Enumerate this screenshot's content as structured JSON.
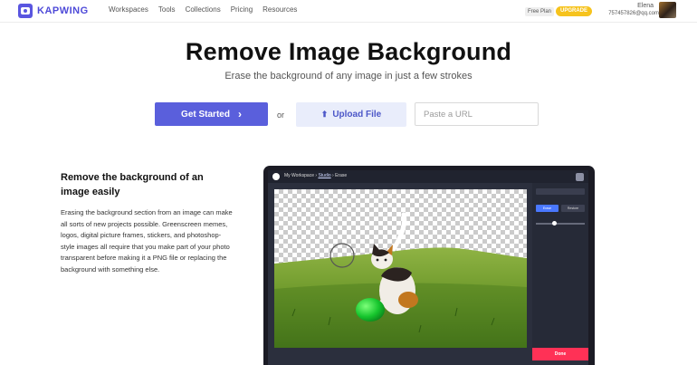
{
  "brand": {
    "name": "KAPWING"
  },
  "nav": {
    "items": [
      "Workspaces",
      "Tools",
      "Collections",
      "Pricing",
      "Resources"
    ]
  },
  "account": {
    "plan": "Free Plan",
    "upgrade": "UPGRADE",
    "name": "Elena",
    "email": "757457826@qq.com"
  },
  "hero": {
    "title": "Remove Image Background",
    "subtitle": "Erase the background of any image in just a few strokes",
    "get_started": "Get Started",
    "or": "or",
    "upload": "Upload File",
    "url_placeholder": "Paste a URL"
  },
  "section": {
    "title": "Remove the background of an image easily",
    "body": "Erasing the background section from an image can make all sorts of new projects possible. Greenscreen memes, logos, digital picture frames, stickers, and photoshop-style images all require that you make part of your photo transparent before making it a PNG file or replacing the background with something else."
  },
  "screenshot": {
    "workspace": "My Workspace",
    "sep1": "›",
    "studio": "Studio",
    "sep2": "›",
    "page": "Erase",
    "erase": "Erase",
    "restore": "Restore",
    "done": "Done"
  },
  "colors": {
    "accent": "#5a5fdc",
    "upgrade": "#f6c31d",
    "done": "#ff3156"
  }
}
